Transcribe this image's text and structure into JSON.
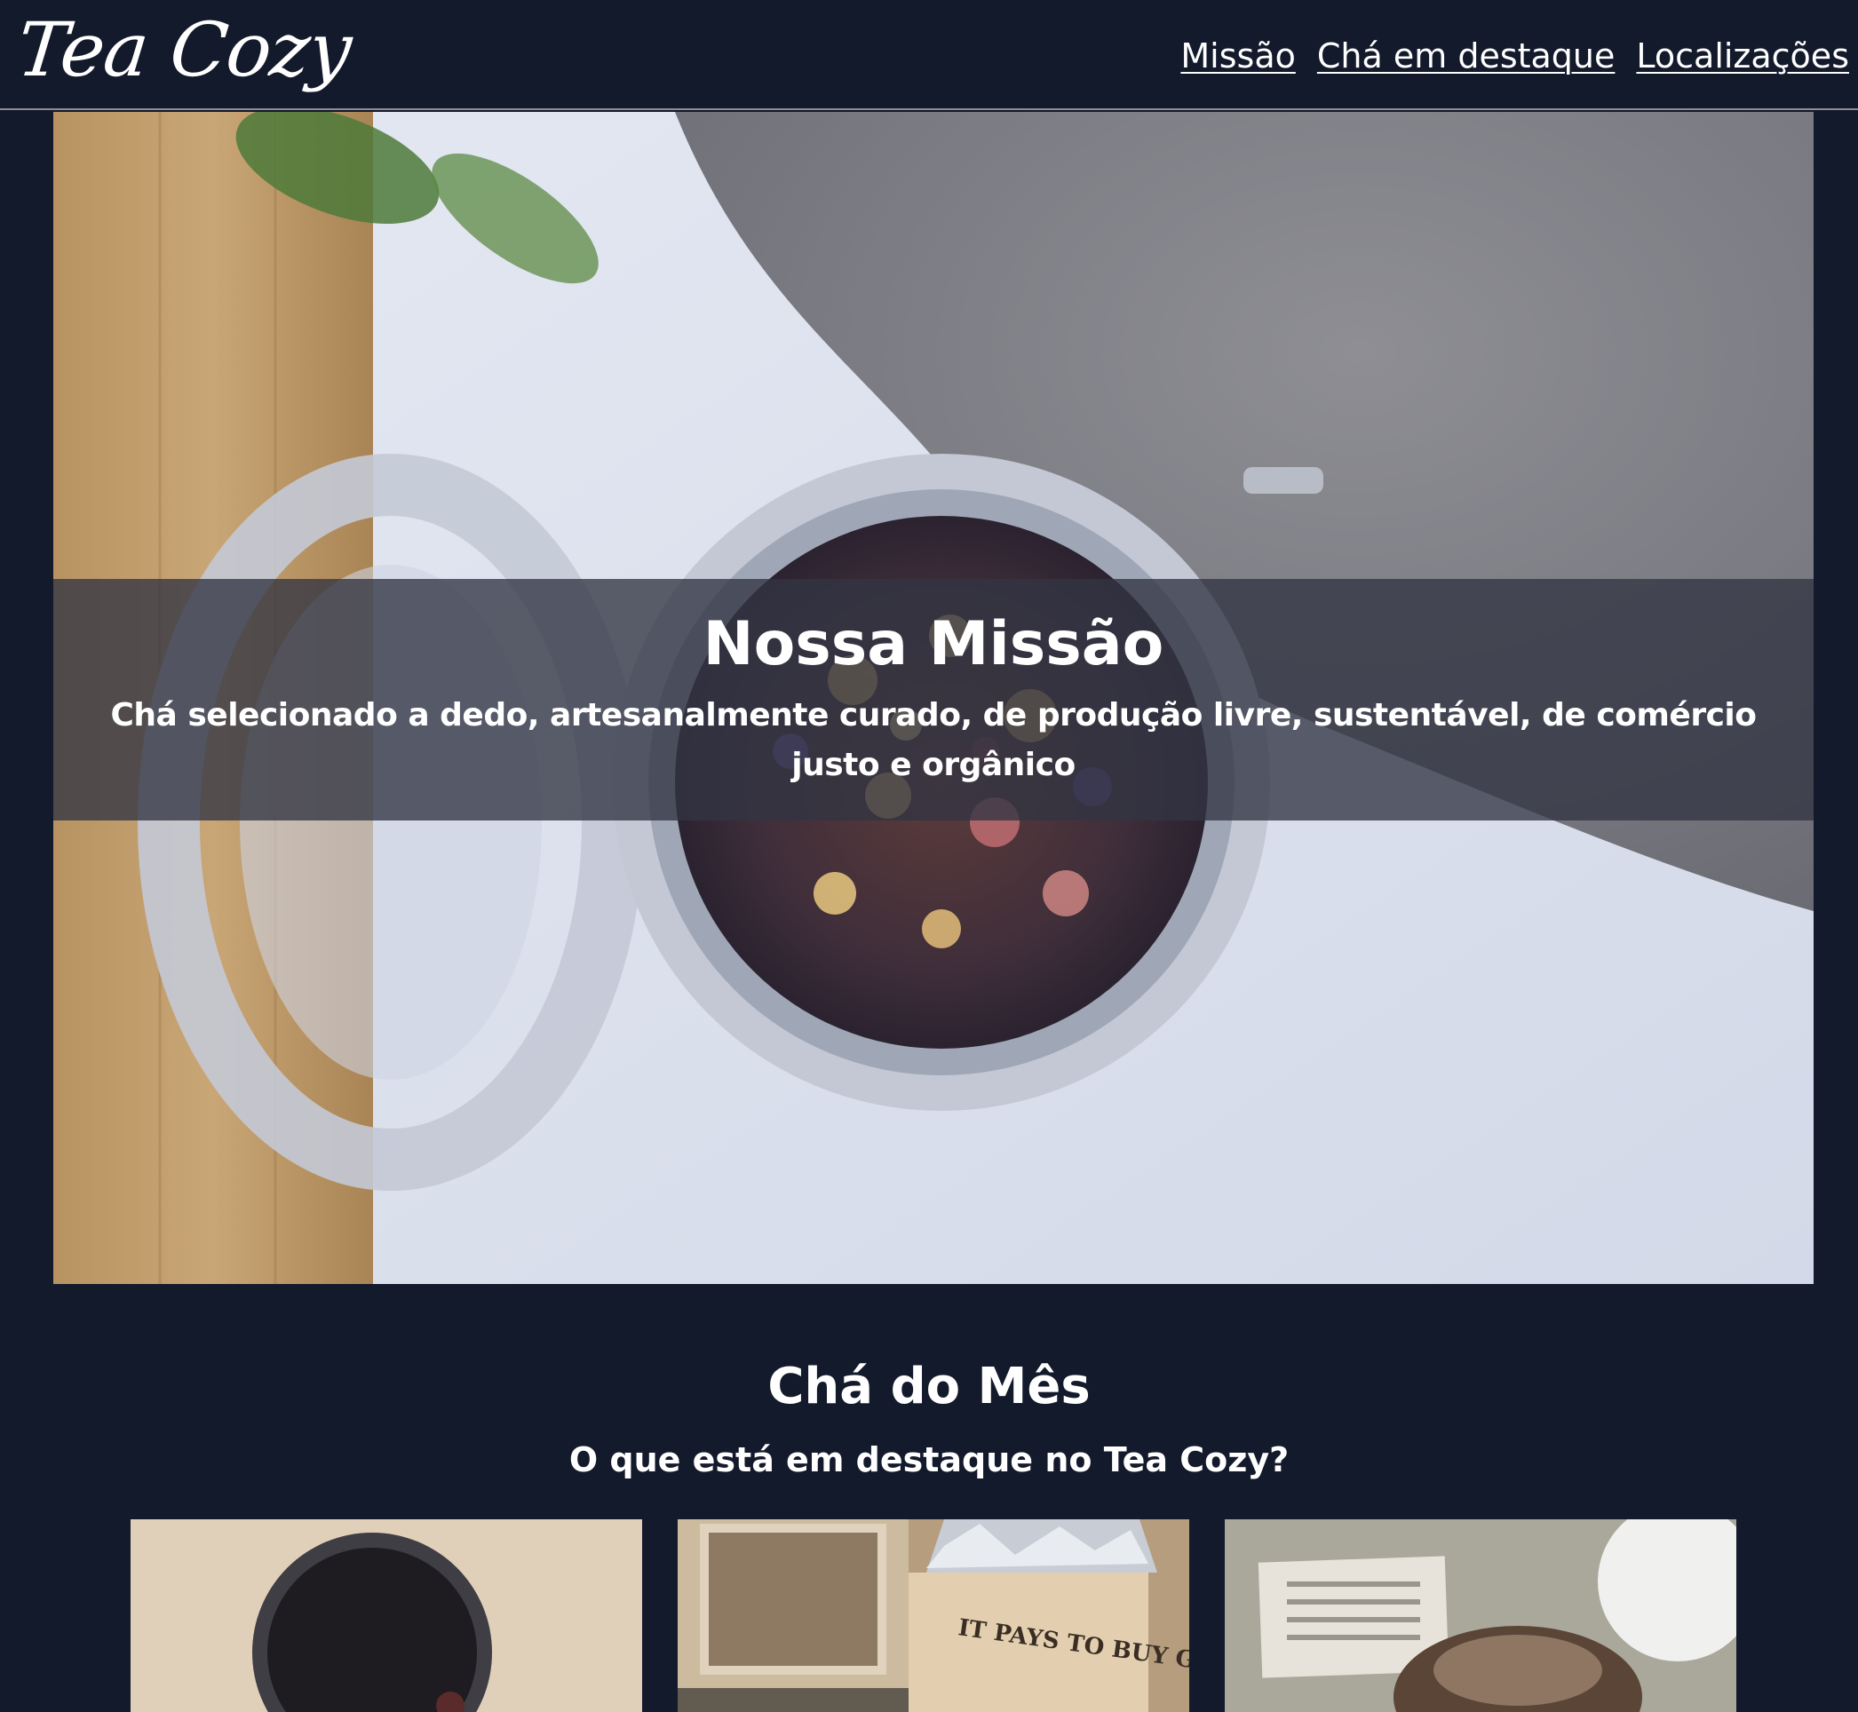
{
  "header": {
    "logo_text": "Tea Cozy",
    "nav": [
      {
        "label": "Missão"
      },
      {
        "label": "Chá em destaque"
      },
      {
        "label": "Localizações"
      }
    ]
  },
  "hero": {
    "image": "loose-leaf-tea-jar-photo",
    "title": "Nossa Missão",
    "text": "Chá selecionado a dedo, artesanalmente curado, de produção livre, sustentável, de comércio justo e orgânico"
  },
  "featured": {
    "title": "Chá do Mês",
    "subtitle": "O que está em destaque no Tea Cozy?",
    "cards": [
      {
        "image": "tea-cup-on-wood-photo"
      },
      {
        "image": "tea-crate-photo",
        "crate_text": "IT PAYS TO BUY GOOD"
      },
      {
        "image": "tea-and-cake-photo"
      }
    ]
  },
  "colors": {
    "background": "#131A2C",
    "text": "#FFFFFF",
    "mission_band": "rgba(50,52,66,0.78)",
    "header_border": "#8E8F95"
  }
}
